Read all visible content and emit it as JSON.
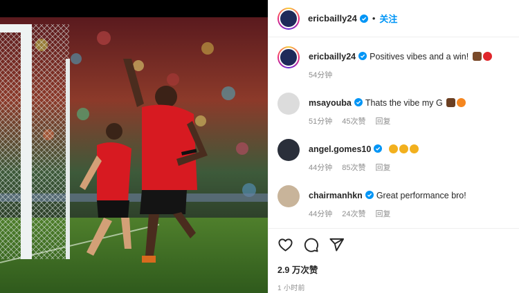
{
  "post": {
    "author": "ericbailly24",
    "follow_label": "关注",
    "separator": "•",
    "caption": "Positives vibes and a win!",
    "caption_age": "54分钟",
    "likes": "2.9 万次赞",
    "posted": "1 小时前"
  },
  "comments": [
    {
      "user": "msayouba",
      "text": "Thats the vibe my G",
      "age": "51分钟",
      "likes": "45次赞",
      "reply": "回复",
      "emoji": [
        "flexed-biceps-emoji",
        "fire-emoji"
      ]
    },
    {
      "user": "angel.gomes10",
      "text": "",
      "age": "44分钟",
      "likes": "85次赞",
      "reply": "回复",
      "emoji": [
        "star-struck-emoji",
        "star-struck-emoji",
        "star-struck-emoji"
      ]
    },
    {
      "user": "chairmanhkn",
      "text": "Great performance bro!",
      "age": "44分钟",
      "likes": "24次赞",
      "reply": "回复",
      "emoji": []
    }
  ],
  "icons": {
    "like": "heart-icon",
    "comment": "comment-bubble-icon",
    "share": "paper-plane-icon",
    "verified": "verified-badge-icon"
  },
  "colors": {
    "accent": "#0095f6",
    "verified": "#0095f6",
    "muted": "#8e8e8e",
    "jersey_red": "#d71a21"
  }
}
